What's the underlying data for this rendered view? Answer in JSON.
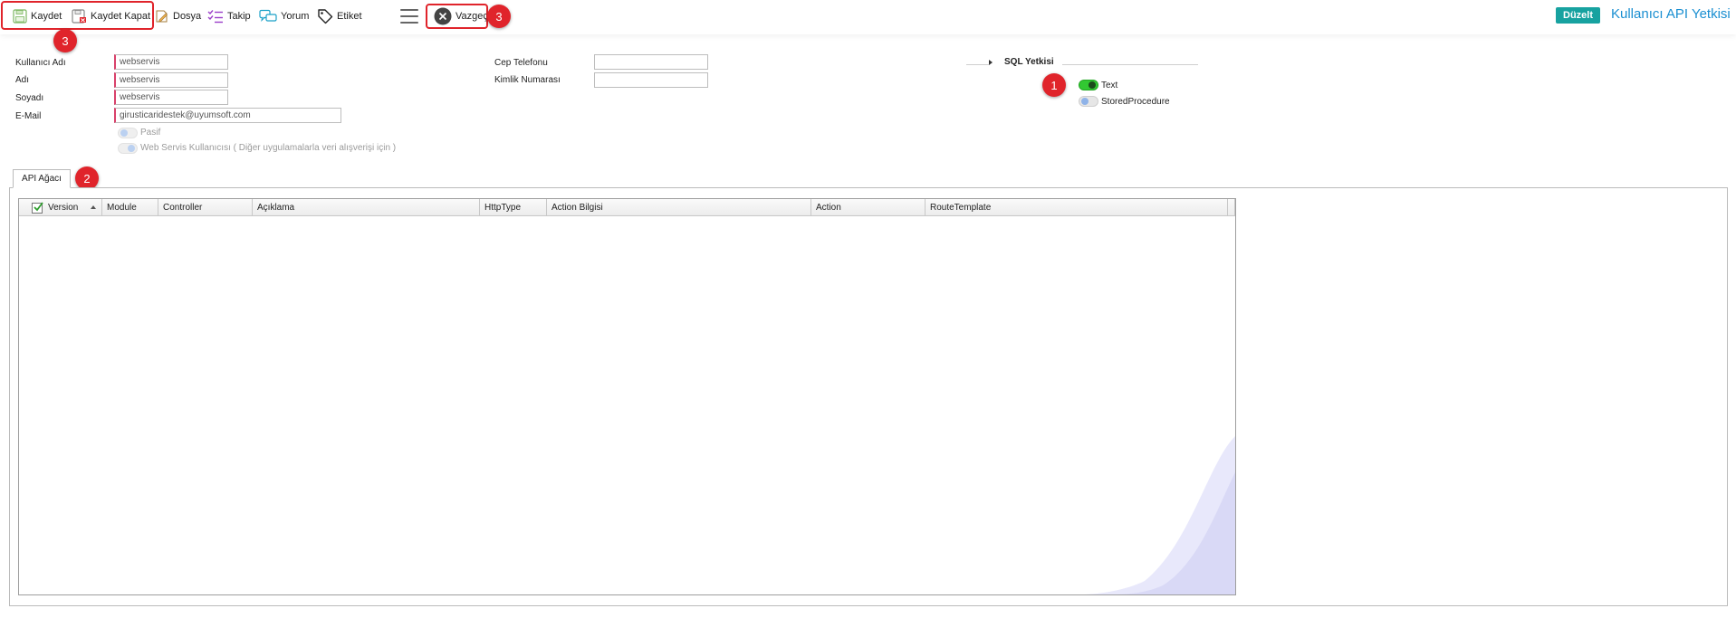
{
  "toolbar": {
    "kaydet": "Kaydet",
    "kaydet_kapat": "Kaydet Kapat",
    "dosya": "Dosya",
    "takip": "Takip",
    "yorum": "Yorum",
    "etiket": "Etiket",
    "vazgec": "Vazgeç",
    "duzelt": "Düzelt",
    "page_title": "Kullanıcı API Yetkisi"
  },
  "annotations": {
    "marker_save": "3",
    "marker_cancel": "3",
    "marker_sql": "1",
    "marker_tab": "2"
  },
  "form": {
    "kullanici_adi": {
      "label": "Kullanıcı Adı",
      "value": "webservis"
    },
    "adi": {
      "label": "Adı",
      "value": "webservis"
    },
    "soyadi": {
      "label": "Soyadı",
      "value": "webservis"
    },
    "email": {
      "label": "E-Mail",
      "value": "girusticaridestek@uyumsoft.com"
    },
    "pasif": {
      "label": "Pasif",
      "checked": false
    },
    "web_servis": {
      "label": "Web Servis Kullanıcısı ( Diğer uygulamalarla veri alışverişi için )",
      "checked": true
    },
    "cep_telefonu": {
      "label": "Cep Telefonu",
      "value": ""
    },
    "kimlik_numarasi": {
      "label": "Kimlik Numarası",
      "value": ""
    }
  },
  "sql_yetkisi": {
    "title": "SQL Yetkisi",
    "options": [
      {
        "label": "Text",
        "on": true
      },
      {
        "label": "StoredProcedure",
        "on": false
      }
    ]
  },
  "tabs": [
    {
      "label": "API Ağacı",
      "active": true
    }
  ],
  "grid": {
    "columns": [
      "Version",
      "Module",
      "Controller",
      "Açıklama",
      "HttpType",
      "Action Bilgisi",
      "Action",
      "RouteTemplate"
    ],
    "rows": []
  },
  "colors": {
    "accent": "#1a8fd1",
    "duzelt": "#17a2a0",
    "annotation": "#e0242b",
    "toggle_on": "#32c832"
  }
}
